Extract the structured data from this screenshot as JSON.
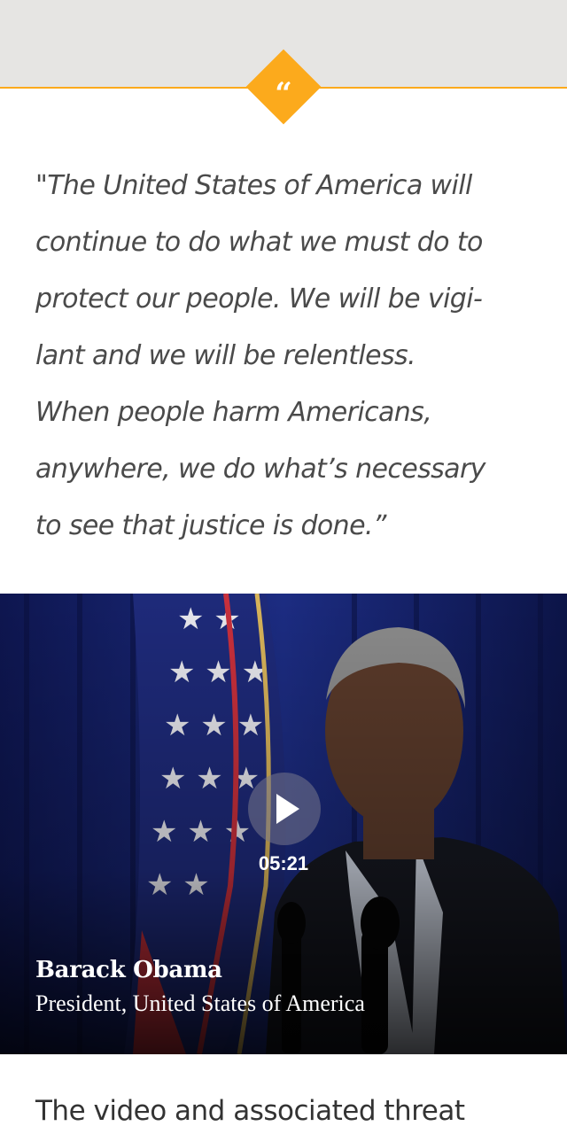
{
  "colors": {
    "accent": "#fcaa1c",
    "top_band": "#e6e5e3",
    "quote_text": "#4a4a4a",
    "body_text": "#333333",
    "caption_text": "#ffffff"
  },
  "quote": {
    "badge_icon": "quote-icon",
    "badge_glyph": "“",
    "lines": [
      "\"The United States of America will",
      "continue to do what we must do to",
      "protect our people.  We will be vigi-",
      "lant and we will be relentless.",
      "When people harm Americans,",
      "anywhere, we do what’s necessary",
      "to see that justice is done.”"
    ]
  },
  "video": {
    "play_icon": "play-icon",
    "duration": "05:21",
    "speaker_name": "Barack Obama",
    "speaker_title": "President, United States of America"
  },
  "article": {
    "lead_text": "The video and associated threat"
  }
}
